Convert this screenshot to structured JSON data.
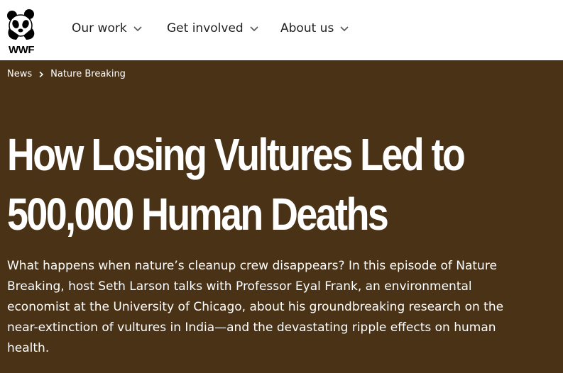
{
  "brand": {
    "logo_text": "WWF",
    "colors": {
      "header_bg": "#ffffff",
      "hero_bg": "#4a3216",
      "text_light": "#ffffff",
      "text_dark": "#222222"
    }
  },
  "nav": {
    "items": [
      {
        "label": "Our work",
        "icon": "chevron-down-icon"
      },
      {
        "label": "Get involved",
        "icon": "chevron-down-icon"
      },
      {
        "label": "About us",
        "icon": "chevron-down-icon"
      }
    ]
  },
  "breadcrumb": {
    "items": [
      {
        "label": "News"
      },
      {
        "label": "Nature Breaking"
      }
    ],
    "separator_icon": "chevron-right-icon"
  },
  "article": {
    "title_line1": "How Losing Vultures Led to",
    "title_line2": "500,000 Human Deaths",
    "intro": "What happens when nature’s cleanup crew disappears? In this episode of Nature Breaking, host Seth Larson talks with Professor Eyal Frank, an environmental economist at the University of Chicago, about his groundbreaking research on the near-extinction of vultures in India—and the devastating ripple effects on human health."
  }
}
